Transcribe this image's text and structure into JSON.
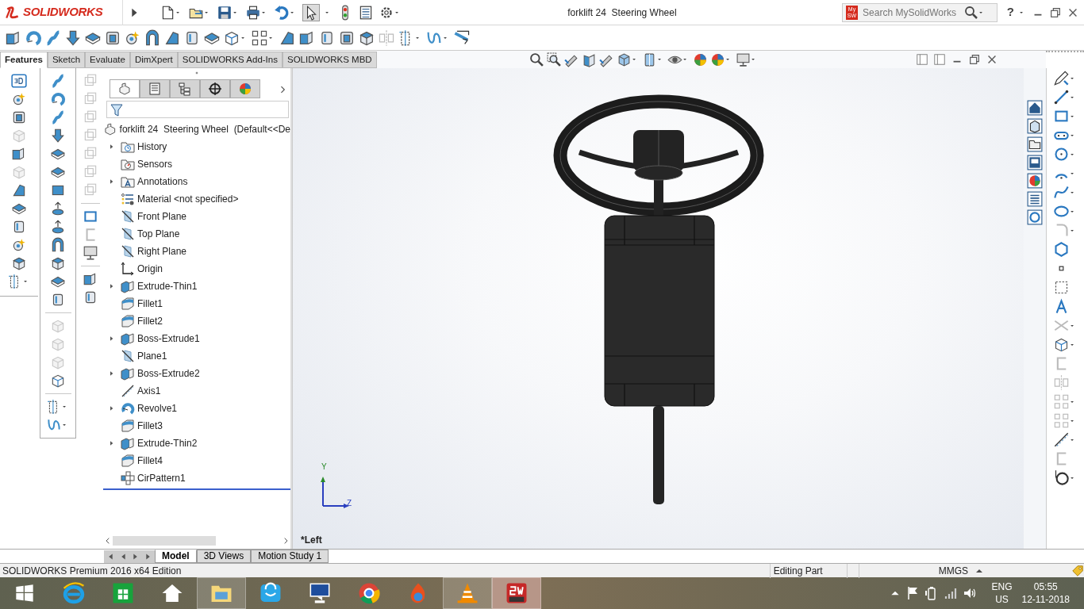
{
  "app": {
    "logo": "SOLIDWORKS"
  },
  "window": {
    "title": "forklift 24  Steering Wheel"
  },
  "search": {
    "badge_lines": [
      "My",
      "SW"
    ],
    "placeholder": "Search MySolidWorks"
  },
  "help": "?",
  "tabs": [
    {
      "label": "Features",
      "selected": true
    },
    {
      "label": "Sketch",
      "selected": false
    },
    {
      "label": "Evaluate",
      "selected": false
    },
    {
      "label": "DimXpert",
      "selected": false
    },
    {
      "label": "SOLIDWORKS Add-Ins",
      "selected": false
    },
    {
      "label": "SOLIDWORKS MBD",
      "selected": false
    }
  ],
  "panel_tabs": [
    {
      "kind": "features",
      "selected": true
    },
    {
      "kind": "properties",
      "selected": false
    },
    {
      "kind": "configurations",
      "selected": false
    },
    {
      "kind": "dimxpert",
      "selected": false
    },
    {
      "kind": "appearance",
      "selected": false
    }
  ],
  "feature_tree": {
    "root": "forklift 24  Steering Wheel  (Default<<De",
    "items": [
      {
        "label": "History",
        "kind": "history",
        "collapsible": true
      },
      {
        "label": "Sensors",
        "kind": "sensors",
        "collapsible": false
      },
      {
        "label": "Annotations",
        "kind": "annotations",
        "collapsible": true
      },
      {
        "label": "Material <not specified>",
        "kind": "material",
        "collapsible": false
      },
      {
        "label": "Front Plane",
        "kind": "plane",
        "collapsible": false
      },
      {
        "label": "Top Plane",
        "kind": "plane",
        "collapsible": false
      },
      {
        "label": "Right Plane",
        "kind": "plane",
        "collapsible": false
      },
      {
        "label": "Origin",
        "kind": "origin",
        "collapsible": false
      },
      {
        "label": "Extrude-Thin1",
        "kind": "extrude",
        "collapsible": true
      },
      {
        "label": "Fillet1",
        "kind": "fillet",
        "collapsible": false
      },
      {
        "label": "Fillet2",
        "kind": "fillet",
        "collapsible": false
      },
      {
        "label": "Boss-Extrude1",
        "kind": "extrude",
        "collapsible": true
      },
      {
        "label": "Plane1",
        "kind": "plane",
        "collapsible": false
      },
      {
        "label": "Boss-Extrude2",
        "kind": "extrude",
        "collapsible": true
      },
      {
        "label": "Axis1",
        "kind": "axis",
        "collapsible": false
      },
      {
        "label": "Revolve1",
        "kind": "revolve",
        "collapsible": true
      },
      {
        "label": "Fillet3",
        "kind": "fillet",
        "collapsible": false
      },
      {
        "label": "Extrude-Thin2",
        "kind": "extrude",
        "collapsible": true
      },
      {
        "label": "Fillet4",
        "kind": "fillet",
        "collapsible": false
      },
      {
        "label": "CirPattern1",
        "kind": "pattern",
        "collapsible": false
      }
    ]
  },
  "viewport": {
    "view_name": "*Left",
    "triad": {
      "y": "Y",
      "z": "Z"
    }
  },
  "bottom_tabs": [
    {
      "label": "Model",
      "selected": true
    },
    {
      "label": "3D Views",
      "selected": false
    },
    {
      "label": "Motion Study 1",
      "selected": false
    }
  ],
  "status_bar": {
    "edition": "SOLIDWORKS Premium 2016 x64 Edition",
    "mode": "Editing Part",
    "units": "MMGS"
  },
  "taskbar": {
    "apps": [
      {
        "kind": "browser",
        "running": false,
        "selected": false
      },
      {
        "kind": "store",
        "running": false,
        "selected": false
      },
      {
        "kind": "home",
        "running": false,
        "selected": false
      },
      {
        "kind": "explorer",
        "running": true,
        "selected": false
      },
      {
        "kind": "shop",
        "running": false,
        "selected": false
      },
      {
        "kind": "monitor",
        "running": false,
        "selected": false
      },
      {
        "kind": "chrome",
        "running": false,
        "selected": false
      },
      {
        "kind": "flame",
        "running": false,
        "selected": false
      },
      {
        "kind": "cone",
        "running": true,
        "selected": false
      },
      {
        "kind": "cad",
        "running": true,
        "selected": true
      }
    ],
    "language": "ENG",
    "region": "US",
    "time": "05:55",
    "date": "12-11-2018"
  }
}
